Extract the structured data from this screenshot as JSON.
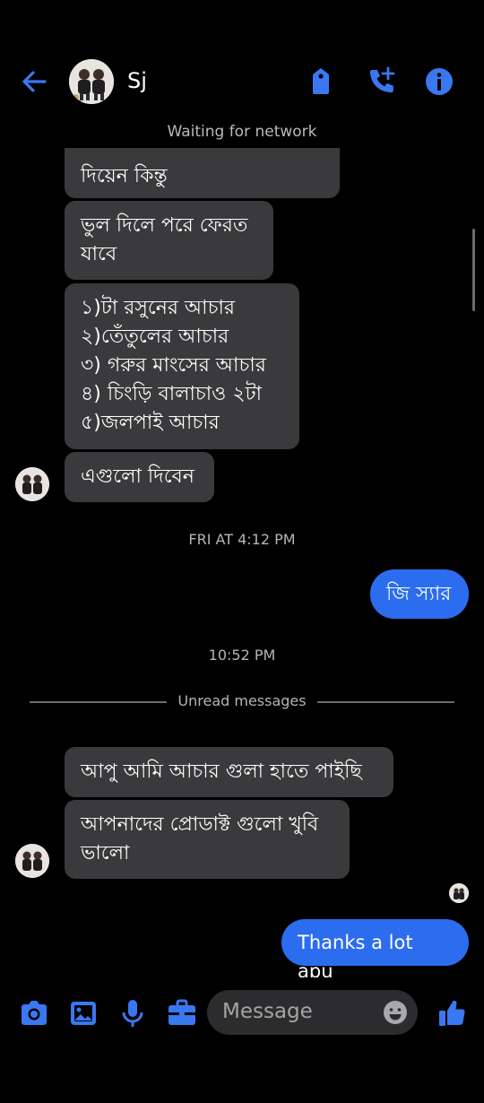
{
  "header": {
    "contact_name": "Sj",
    "network_status": "Waiting for network"
  },
  "messages_in_top": [
    {
      "text": "দিয়েন কিন্তু"
    },
    {
      "text": "ভুল দিলে পরে ফেরত\nযাবে"
    },
    {
      "text": "১)টা রসুনের আচার\n২)তেঁতুলের আচার\n৩) গরুর মাংসের আচার\n৪) চিংড়ি বালাচাও ২টা\n৫)জলপাই আচার"
    },
    {
      "text": "এগুলো দিবেন"
    }
  ],
  "timestamp_1": "FRI AT 4:12 PM",
  "message_out_1": "জি স্যার",
  "timestamp_2": "10:52 PM",
  "unread_label": "Unread messages",
  "messages_in_bottom": [
    {
      "text": "আপু আমি আচার গুলা হাতে পাইছি"
    },
    {
      "text": "আপনাদের প্রোডাক্ট গুলো খুবি\nভালো"
    }
  ],
  "message_out_2": "Thanks a lot apu",
  "composer": {
    "placeholder": "Message"
  },
  "icons": {
    "back": "arrow-left-icon",
    "tag": "tag-icon",
    "call": "phone-add-icon",
    "info": "info-icon",
    "camera": "camera-icon",
    "image": "image-icon",
    "mic": "microphone-icon",
    "briefcase": "briefcase-icon",
    "emoji": "emoji-icon",
    "like": "thumbs-up-icon"
  },
  "colors": {
    "accent": "#2f6df2",
    "outgoing_bubble": "#2c6df0",
    "incoming_bubble": "#3a3a3c",
    "background": "#000000"
  }
}
